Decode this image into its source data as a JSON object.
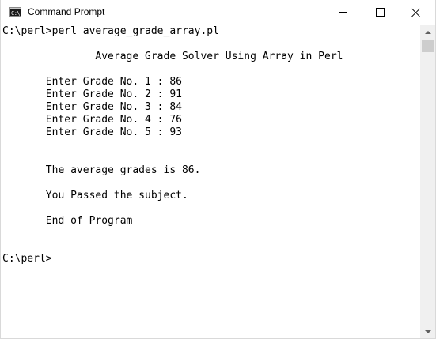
{
  "window": {
    "title": "Command Prompt",
    "icon": "cmd-icon",
    "icon_glyph": "C:\\"
  },
  "controls": {
    "minimize": "minimize-icon",
    "maximize": "maximize-icon",
    "close": "close-icon"
  },
  "console": {
    "lines": [
      "C:\\perl>perl average_grade_array.pl",
      "",
      "               Average Grade Solver Using Array in Perl",
      "",
      "       Enter Grade No. 1 : 86",
      "       Enter Grade No. 2 : 91",
      "       Enter Grade No. 3 : 84",
      "       Enter Grade No. 4 : 76",
      "       Enter Grade No. 5 : 93",
      "",
      "",
      "       The average grades is 86.",
      "",
      "       You Passed the subject.",
      "",
      "       End of Program",
      "",
      "",
      "C:\\perl>"
    ]
  }
}
